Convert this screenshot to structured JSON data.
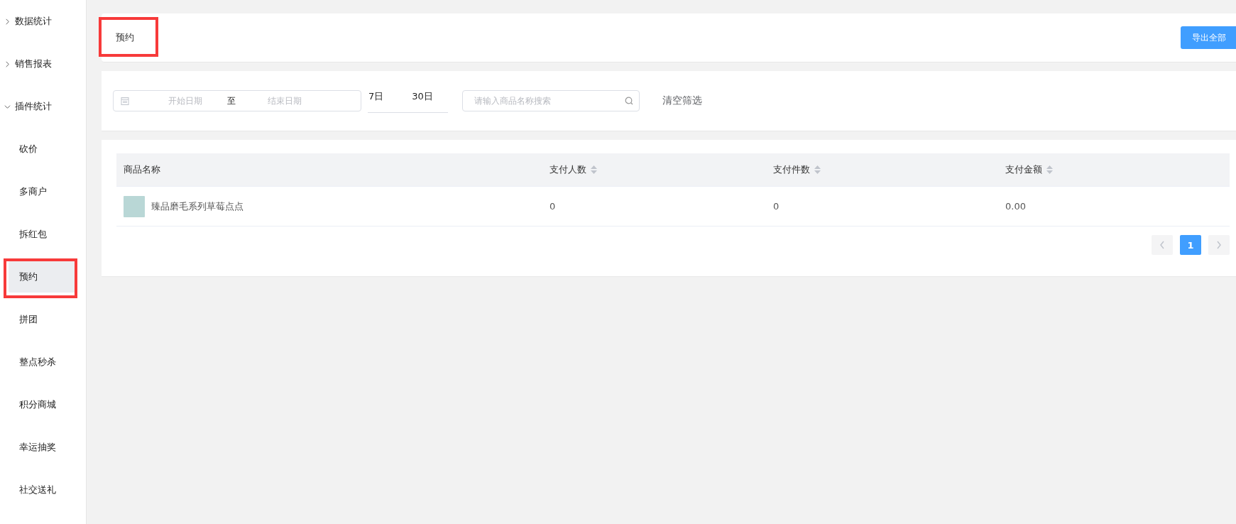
{
  "sidebar": {
    "items": [
      {
        "label": "数据统计",
        "expanded": false
      },
      {
        "label": "销售报表",
        "expanded": false
      },
      {
        "label": "插件统计",
        "expanded": true,
        "children": [
          {
            "label": "砍价",
            "selected": false
          },
          {
            "label": "多商户",
            "selected": false
          },
          {
            "label": "拆红包",
            "selected": false
          },
          {
            "label": "预约",
            "selected": true,
            "highlighted": true
          },
          {
            "label": "拼团",
            "selected": false
          },
          {
            "label": "整点秒杀",
            "selected": false
          },
          {
            "label": "积分商城",
            "selected": false
          },
          {
            "label": "幸运抽奖",
            "selected": false
          },
          {
            "label": "社交送礼",
            "selected": false
          }
        ]
      }
    ]
  },
  "header": {
    "title": "预约",
    "highlighted": true,
    "export_button": "导出全部"
  },
  "filters": {
    "start_date": {
      "placeholder": "开始日期"
    },
    "range_separator": "至",
    "end_date": {
      "placeholder": "结束日期"
    },
    "quick_ranges": [
      {
        "label": "7日",
        "selected": false
      },
      {
        "label": "30日",
        "selected": false
      }
    ],
    "search": {
      "placeholder": "请输入商品名称搜索"
    },
    "clear": "清空筛选"
  },
  "table": {
    "columns": [
      {
        "label": "商品名称",
        "sortable": false
      },
      {
        "label": "支付人数",
        "sortable": true
      },
      {
        "label": "支付件数",
        "sortable": true
      },
      {
        "label": "支付金额",
        "sortable": true
      }
    ],
    "rows": [
      [
        "臻品磨毛系列草莓点点",
        "0",
        "0",
        "0.00"
      ]
    ]
  },
  "pagination": {
    "pages": [
      {
        "label": "1",
        "selected": true
      }
    ]
  }
}
